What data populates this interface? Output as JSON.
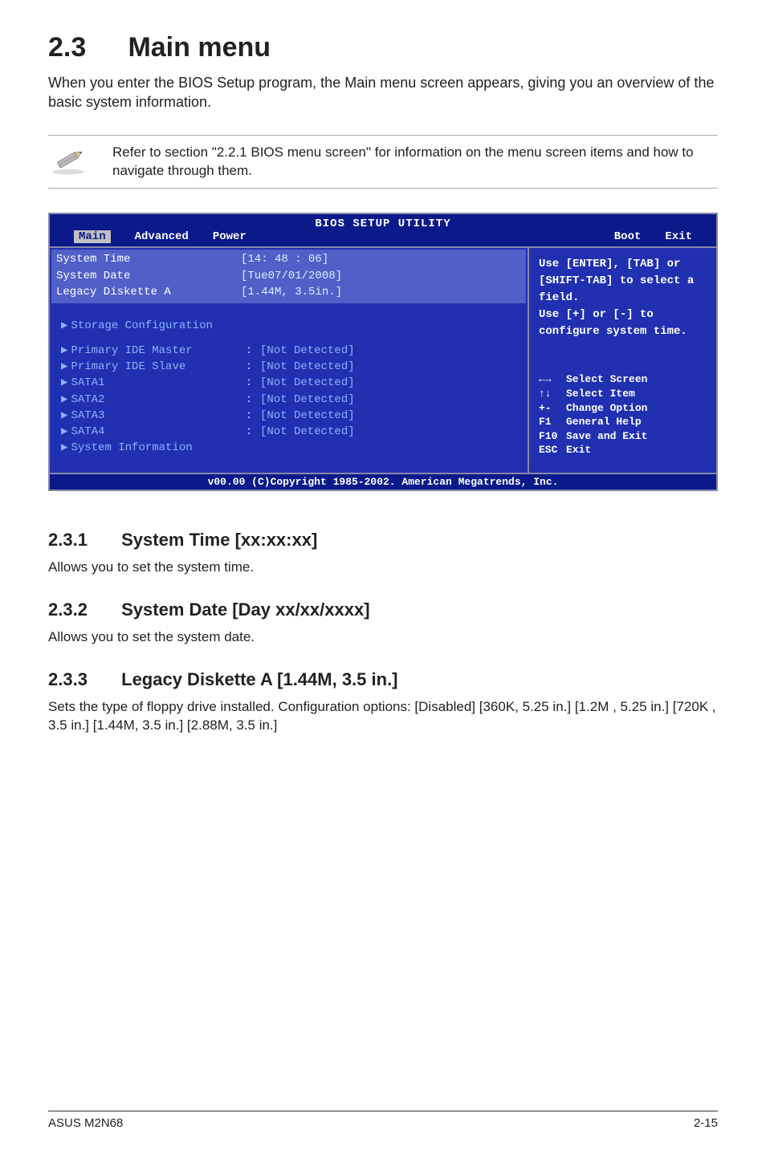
{
  "heading": {
    "num": "2.3",
    "title": "Main menu"
  },
  "intro": "When you enter the BIOS Setup program, the Main menu screen appears, giving you an overview of the basic system information.",
  "note": "Refer to section \"2.2.1  BIOS menu screen\" for information on the menu screen items and how to navigate through them.",
  "bios": {
    "title": "BIOS SETUP UTILITY",
    "tabs": [
      "Main",
      "Advanced",
      "Power",
      "Boot",
      "Exit"
    ],
    "selected_tab": 0,
    "sys": {
      "time_label": "System Time",
      "time_value": "[14: 48 : 06]",
      "date_label": "System Date",
      "date_value": "[Tue07/01/2008]",
      "legacy_label": "Legacy Diskette A",
      "legacy_value": "[1.44M, 3.5in.]"
    },
    "storage_label": "Storage Configuration",
    "rows": [
      {
        "label": "Primary IDE Master",
        "value": "[Not Detected]"
      },
      {
        "label": "Primary IDE Slave",
        "value": "[Not Detected]"
      },
      {
        "label": "SATA1",
        "value": "[Not Detected]"
      },
      {
        "label": "SATA2",
        "value": "[Not Detected]"
      },
      {
        "label": "SATA3",
        "value": "[Not Detected]"
      },
      {
        "label": "SATA4",
        "value": "[Not Detected]"
      }
    ],
    "sysinfo_label": "System Information",
    "help_top": "Use [ENTER], [TAB] or [SHIFT-TAB] to select a field.\nUse [+] or [-] to configure system time.",
    "help_keys": [
      {
        "k": "←→",
        "t": "Select Screen"
      },
      {
        "k": "↑↓",
        "t": "Select Item"
      },
      {
        "k": "+-",
        "t": "Change Option"
      },
      {
        "k": "F1",
        "t": "General Help"
      },
      {
        "k": "F10",
        "t": "Save and Exit"
      },
      {
        "k": "ESC",
        "t": "Exit"
      }
    ],
    "footer": "v00.00 (C)Copyright 1985-2002. American Megatrends, Inc."
  },
  "sections": [
    {
      "num": "2.3.1",
      "title": "System Time [xx:xx:xx]",
      "body": "Allows you to set the system time."
    },
    {
      "num": "2.3.2",
      "title": "System Date [Day xx/xx/xxxx]",
      "body": "Allows you to set the system date."
    },
    {
      "num": "2.3.3",
      "title": "Legacy Diskette A [1.44M, 3.5 in.]",
      "body": "Sets the type of floppy drive installed. Configuration options: [Disabled] [360K, 5.25 in.] [1.2M , 5.25 in.] [720K , 3.5 in.] [1.44M, 3.5 in.] [2.88M, 3.5 in.]"
    }
  ],
  "footer": {
    "left": "ASUS M2N68",
    "right": "2-15"
  }
}
